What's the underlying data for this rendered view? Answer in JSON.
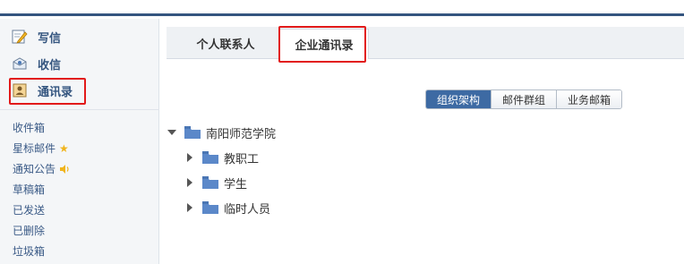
{
  "sidebar": {
    "actions": {
      "write": {
        "label": "写信",
        "icon": "pencil-edit-icon"
      },
      "receive": {
        "label": "收信",
        "icon": "inbox-icon"
      },
      "contacts": {
        "label": "通讯录",
        "icon": "contact-book-icon"
      }
    },
    "folders": {
      "inbox": "收件箱",
      "starred": "星标邮件",
      "notices": "通知公告",
      "drafts": "草稿箱",
      "sent": "已发送",
      "deleted": "已删除",
      "trash": "垃圾箱"
    }
  },
  "tabs": {
    "personal": "个人联系人",
    "enterprise": "企业通讯录",
    "active": "enterprise"
  },
  "view_switch": {
    "org": "组织架构",
    "groups": "邮件群组",
    "business": "业务邮箱",
    "active": "org"
  },
  "tree": {
    "root": "南阳师范学院",
    "children": {
      "c1": "教职工",
      "c2": "学生",
      "c3": "临时人员"
    }
  },
  "colors": {
    "brand_blue": "#34557f",
    "highlight_red": "#e21a1a",
    "folder_blue": "#5b88c9",
    "active_segment": "#3d6aa3"
  }
}
